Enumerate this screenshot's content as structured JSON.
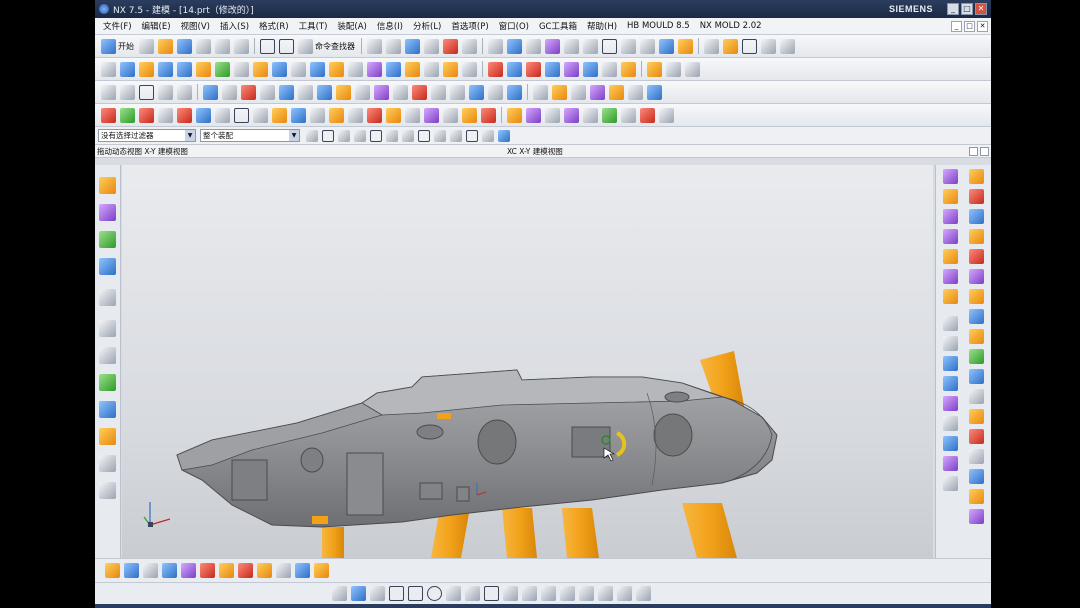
{
  "window": {
    "title": "NX 7.5 - 建模 - [14.prt（修改的）]",
    "brand": "SIEMENS",
    "controls": [
      "_",
      "□",
      "✕"
    ]
  },
  "menu": {
    "items": [
      "文件(F)",
      "编辑(E)",
      "视图(V)",
      "插入(S)",
      "格式(R)",
      "工具(T)",
      "装配(A)",
      "信息(I)",
      "分析(L)",
      "首选项(P)",
      "窗口(O)",
      "GC工具箱",
      "帮助(H)",
      "HB MOULD 8.5",
      "NX MOLD 2.02"
    ]
  },
  "toolbar1": {
    "start_label": "开始",
    "command_finder_label": "命令查找器"
  },
  "selection": {
    "filter_value": "没有选择过滤器",
    "scope_value": "整个装配"
  },
  "status": {
    "left": "拖动动态视图 X-Y 建模视图",
    "middle": "XC X-Y 建模视图"
  },
  "colors": {
    "part_gray": "#8e8f92",
    "pin_orange": "#f2a21a",
    "accent_blue": "#2f6fc4"
  },
  "icons": {
    "left_rail": [
      "part-navigator-icon",
      "assembly-navigator-icon",
      "reuse-library-icon",
      "web-browser-icon",
      "history-icon",
      "process-studio-icon",
      "roles-icon",
      "system-materials-icon",
      "palette-icon",
      "mold-wizard-icon",
      "help-icon",
      "history-log-icon"
    ],
    "right_rail_a": [
      "mold-init-icon",
      "mold-csys-icon",
      "shrinkage-icon",
      "workpiece-icon",
      "cavity-layout-icon",
      "mold-tools-icon",
      "parting-icon"
    ],
    "right_rail_b": [
      "mold-base-icon",
      "standard-part-icon",
      "ejector-pin-icon",
      "sub-insert-icon",
      "slider-icon",
      "gate-icon",
      "runner-icon",
      "cooling-icon"
    ]
  }
}
